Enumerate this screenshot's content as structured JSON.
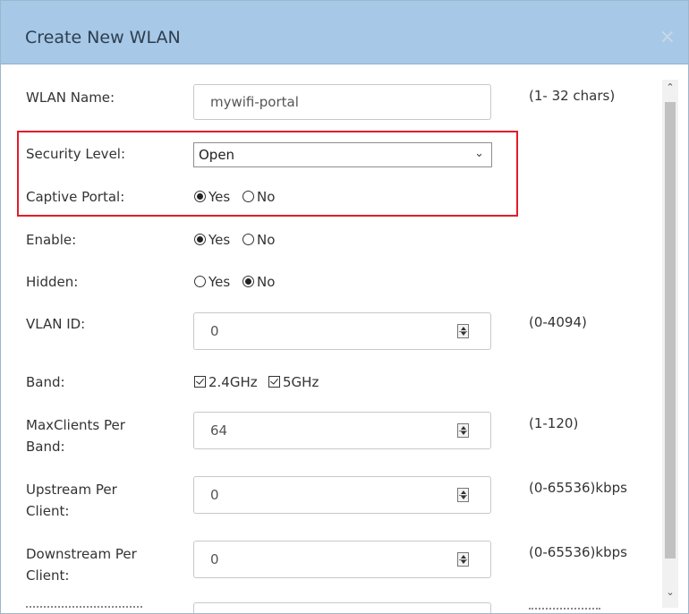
{
  "dialog": {
    "title": "Create New WLAN",
    "close_label": "×"
  },
  "form": {
    "wlan_name": {
      "label": "WLAN Name:",
      "value": "mywifi-portal",
      "hint": "(1- 32 chars)"
    },
    "security_level": {
      "label": "Security Level:",
      "selected": "Open"
    },
    "captive_portal": {
      "label": "Captive Portal:",
      "yes": "Yes",
      "no": "No",
      "value": "Yes"
    },
    "enable": {
      "label": "Enable:",
      "yes": "Yes",
      "no": "No",
      "value": "Yes"
    },
    "hidden": {
      "label": "Hidden:",
      "yes": "Yes",
      "no": "No",
      "value": "No"
    },
    "vlan_id": {
      "label": "VLAN ID:",
      "value": "0",
      "hint": "(0-4094)"
    },
    "band": {
      "label": "Band:",
      "opt1": "2.4GHz",
      "opt2": "5GHz",
      "opt1_checked": true,
      "opt2_checked": true
    },
    "max_clients": {
      "label_line1": "MaxClients Per",
      "label_line2": "Band:",
      "value": "64",
      "hint": "(1-120)"
    },
    "upstream": {
      "label_line1": "Upstream Per",
      "label_line2": "Client:",
      "value": "0",
      "hint": "(0-65536)kbps"
    },
    "downstream": {
      "label_line1": "Downstream Per",
      "label_line2": "Client:",
      "value": "0",
      "hint": "(0-65536)kbps"
    }
  },
  "colors": {
    "header_bg": "#a7c8e6",
    "highlight_border": "#e21c2a"
  },
  "icons": {
    "close": "close-icon",
    "select_chevron": "chevron-down-icon",
    "scroll_up": "scroll-up-arrow-icon",
    "scroll_down": "scroll-down-arrow-icon",
    "spinner": "spinner-arrows-icon"
  }
}
